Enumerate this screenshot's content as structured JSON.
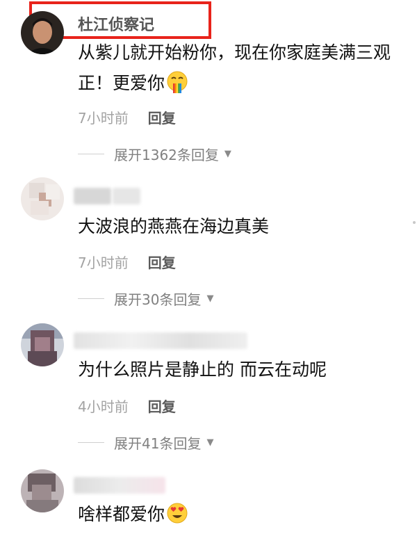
{
  "comments": [
    {
      "username": "杜江侦察记",
      "text": "从紫儿就开始粉你，现在你家庭美满三观正！更爱你",
      "time": "7小时前",
      "reply_label": "回复",
      "expand_label": "展开1362条回复",
      "emoji": "rainbow-vomit-face-icon"
    },
    {
      "username": "",
      "text": "大波浪的燕燕在海边真美",
      "time": "7小时前",
      "reply_label": "回复",
      "expand_label": "展开30条回复"
    },
    {
      "username": "",
      "text": "为什么照片是静止的 而云在动呢",
      "time": "4小时前",
      "reply_label": "回复",
      "expand_label": "展开41条回复"
    },
    {
      "username": "",
      "text": "啥样都爱你",
      "emoji": "heart-eyes-face-icon"
    }
  ],
  "colors": {
    "highlight_box": "#e8231b"
  }
}
